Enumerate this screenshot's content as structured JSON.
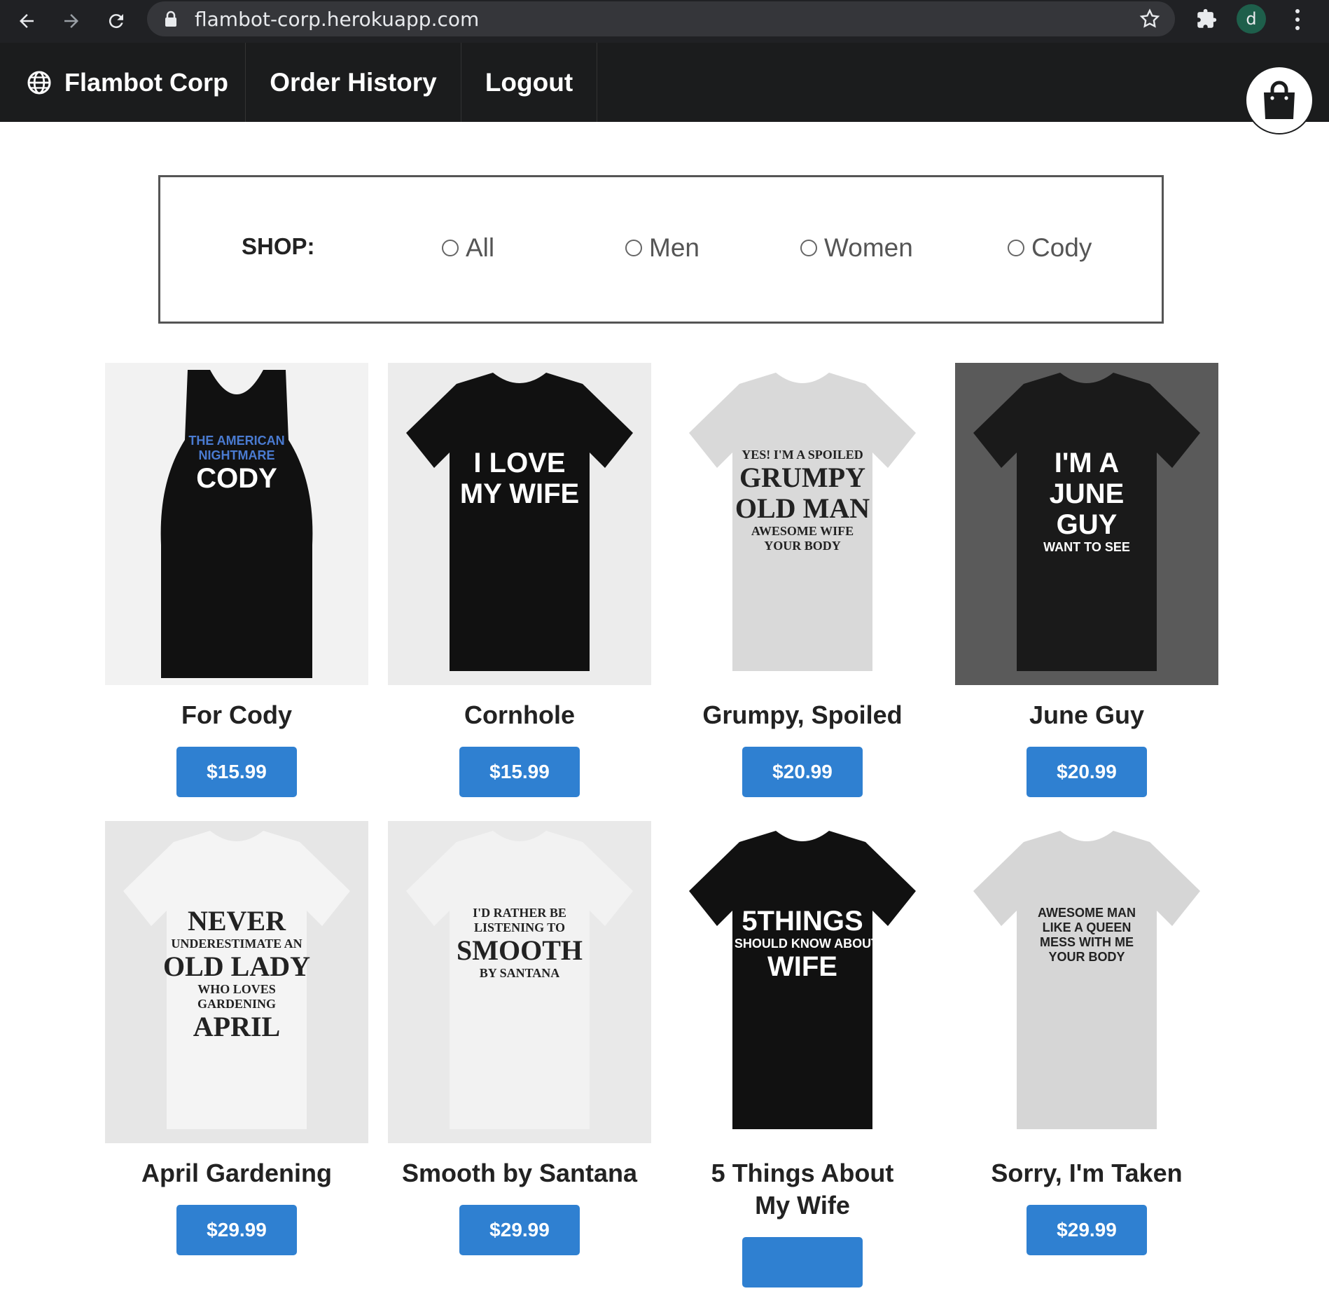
{
  "browser": {
    "url": "flambot-corp.herokuapp.com",
    "profile_initial": "d"
  },
  "header": {
    "brand": "Flambot Corp",
    "menu": [
      "Order History",
      "Logout"
    ]
  },
  "filter": {
    "label": "SHOP:",
    "options": [
      "All",
      "Men",
      "Women",
      "Cody"
    ]
  },
  "products": [
    {
      "title": "For Cody",
      "price": "$15.99",
      "shirt_color": "#111111",
      "bg": "#f2f2f2",
      "shirt_lines": [
        "THE AMERICAN",
        "NIGHTMARE",
        "CODY"
      ]
    },
    {
      "title": "Cornhole",
      "price": "$15.99",
      "shirt_color": "#111111",
      "bg": "#ececec",
      "shirt_lines": [
        "I LOVE",
        "MY WIFE"
      ]
    },
    {
      "title": "Grumpy, Spoiled",
      "price": "$20.99",
      "shirt_color": "#d9d9d9",
      "bg": "#ffffff",
      "shirt_lines": [
        "YES! I'M A SPOILED",
        "GRUMPY",
        "OLD MAN",
        "AWESOME WIFE",
        "YOUR BODY"
      ]
    },
    {
      "title": "June Guy",
      "price": "$20.99",
      "shirt_color": "#1a1a1a",
      "bg": "#5a5a5a",
      "shirt_lines": [
        "I'M A",
        "JUNE",
        "GUY",
        "WANT TO SEE"
      ]
    },
    {
      "title": "April Gardening",
      "price": "$29.99",
      "shirt_color": "#f4f4f4",
      "bg": "#e6e6e6",
      "shirt_lines": [
        "NEVER",
        "UNDERESTIMATE AN",
        "OLD LADY",
        "WHO LOVES",
        "GARDENING",
        "APRIL"
      ]
    },
    {
      "title": "Smooth by Santana",
      "price": "$29.99",
      "shirt_color": "#f2f2f2",
      "bg": "#e9e9e9",
      "shirt_lines": [
        "I'D RATHER BE",
        "LISTENING TO",
        "SMOOTH",
        "BY SANTANA"
      ]
    },
    {
      "title": "5 Things About My Wife",
      "price": "",
      "shirt_color": "#111111",
      "bg": "#ffffff",
      "shirt_lines": [
        "5THINGS",
        "YOU SHOULD KNOW ABOUT MY",
        "WIFE"
      ]
    },
    {
      "title": "Sorry, I'm Taken",
      "price": "$29.99",
      "shirt_color": "#d6d6d6",
      "bg": "#ffffff",
      "shirt_lines": [
        "AWESOME MAN",
        "LIKE A QUEEN",
        "MESS WITH ME",
        "YOUR BODY"
      ]
    }
  ]
}
